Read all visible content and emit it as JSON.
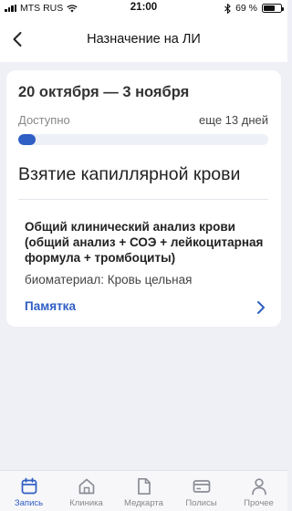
{
  "status_bar": {
    "carrier": "MTS RUS",
    "time": "21:00",
    "battery_percent": "69 %",
    "battery_level": 0.69
  },
  "header": {
    "title": "Назначение на ЛИ",
    "back_icon": "chevron-left-icon"
  },
  "card": {
    "date_range": "20 октября — 3 ноября",
    "availability_label": "Доступно",
    "days_left": "еще 13 дней",
    "progress": 0.07,
    "section_title": "Взятие капиллярной крови",
    "test_name": "Общий клинический анализ крови (общий анализ + СОЭ + лейкоцитарная формула + тромбоциты)",
    "biomaterial": "биоматериал: Кровь цельная",
    "memo_link": "Памятка",
    "accent_color": "#2f5ec4"
  },
  "tabs": [
    {
      "label": "Запись",
      "icon": "calendar-icon",
      "active": true
    },
    {
      "label": "Клиника",
      "icon": "home-icon",
      "active": false
    },
    {
      "label": "Медкарта",
      "icon": "document-icon",
      "active": false
    },
    {
      "label": "Полисы",
      "icon": "card-icon",
      "active": false
    },
    {
      "label": "Прочее",
      "icon": "person-icon",
      "active": false
    }
  ]
}
